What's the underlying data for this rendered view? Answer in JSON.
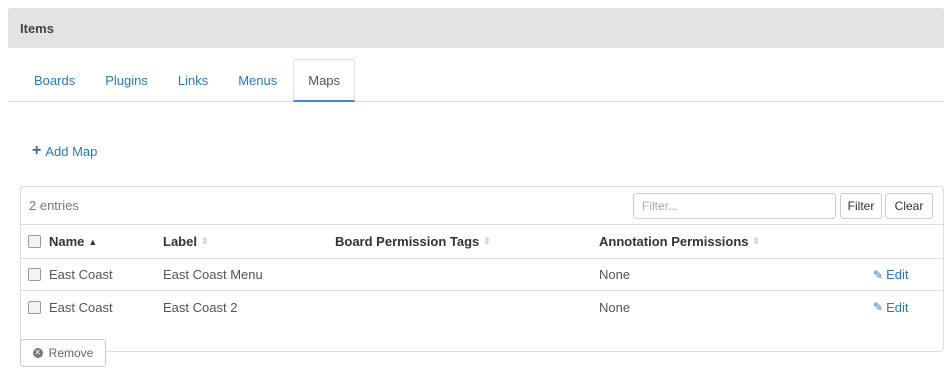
{
  "panel": {
    "title": "Items"
  },
  "tabs": [
    {
      "label": "Boards",
      "active": false
    },
    {
      "label": "Plugins",
      "active": false
    },
    {
      "label": "Links",
      "active": false
    },
    {
      "label": "Menus",
      "active": false
    },
    {
      "label": "Maps",
      "active": true
    }
  ],
  "actions": {
    "add_map": "Add Map",
    "remove": "Remove"
  },
  "table": {
    "entries_text": "2 entries",
    "filter_placeholder": "Filter...",
    "filter_button": "Filter",
    "clear_button": "Clear",
    "columns": [
      "Name",
      "Label",
      "Board Permission Tags",
      "Annotation Permissions"
    ],
    "sort_column": "Name",
    "rows": [
      {
        "name": "East Coast",
        "label": "East Coast Menu",
        "board_permission_tags": "",
        "annotation_permissions": "None",
        "action": "Edit"
      },
      {
        "name": "East Coast",
        "label": "East Coast 2",
        "board_permission_tags": "",
        "annotation_permissions": "None",
        "action": "Edit"
      }
    ]
  },
  "colors": {
    "accent": "#2a7ab8",
    "header_bg": "#e3e3e3",
    "tab_underline": "#3b8ad8"
  }
}
